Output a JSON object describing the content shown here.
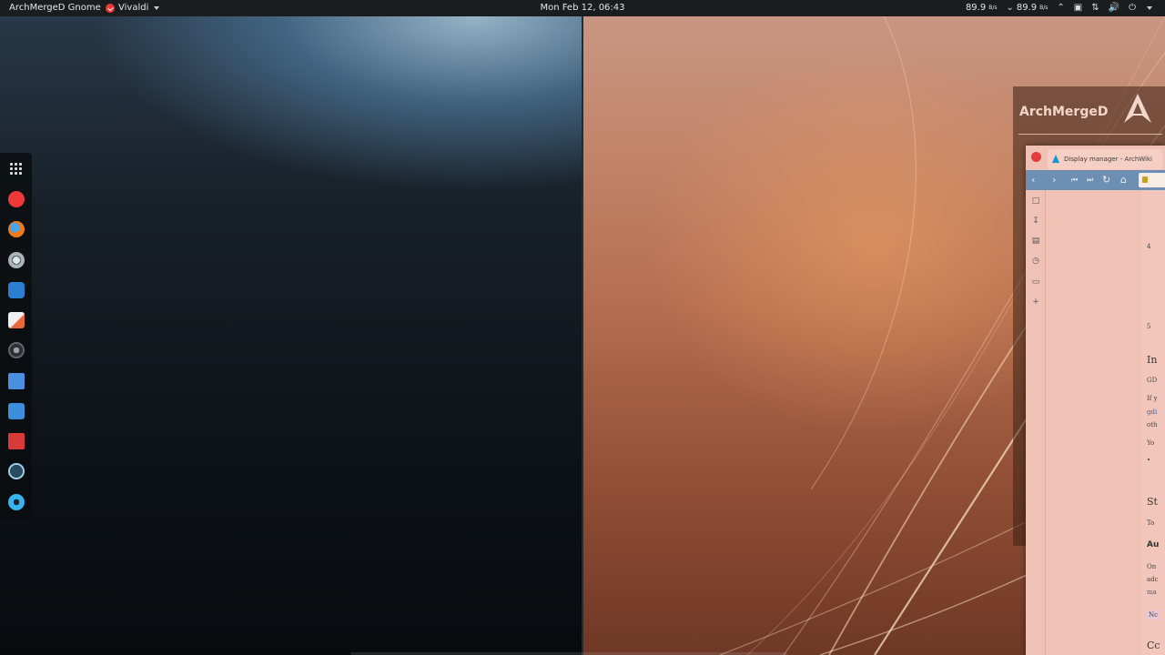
{
  "topbar": {
    "activities": "ArchMergeD Gnome",
    "app_name": "Vivaldi",
    "clock": "Mon Feb 12, 06:43",
    "net_up": "89.9",
    "net_up_unit": "B/s",
    "net_down": "89.9",
    "net_down_unit": "B/s"
  },
  "dash": {
    "items": [
      "show-apps",
      "vivaldi",
      "firefox",
      "chrome",
      "inkscape",
      "text-editor",
      "camera",
      "files",
      "downloader",
      "presentation",
      "monitor",
      "settings"
    ]
  },
  "overview": {
    "arch_window_title": "ArchMergeD",
    "vivaldi_tab_title": "Display manager - ArchWiki",
    "page_headings": [
      "In",
      "St",
      "Au",
      "Cc"
    ],
    "page_lines": [
      "GD",
      "If y",
      "gdi",
      "oth",
      "Yo",
      "•",
      "To",
      "On",
      "adc",
      "ma",
      "Nc"
    ],
    "page_numbers": [
      "4",
      "5"
    ]
  },
  "colors": {
    "topbar_bg": "#1b1c1e",
    "vivaldi_red": "#ef3939",
    "vivaldi_nav": "#6d8fb4",
    "arch_blue": "#1793d1"
  }
}
